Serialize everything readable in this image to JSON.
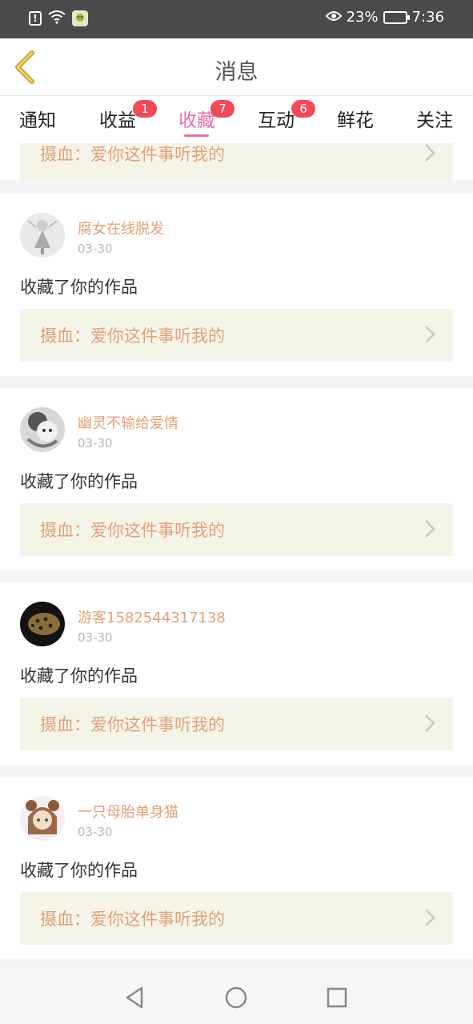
{
  "status_bar": {
    "icons": [
      "alert-icon",
      "wifi-icon",
      "app-notification-icon"
    ],
    "eye_icon": "eye-icon",
    "battery_percent": "23%",
    "time": "7:36"
  },
  "header": {
    "title": "消息",
    "back_icon": "chevron-left-icon"
  },
  "tabs": [
    {
      "label": "通知",
      "badge": ""
    },
    {
      "label": "收益",
      "badge": "1"
    },
    {
      "label": "收藏",
      "badge": "7",
      "active": true
    },
    {
      "label": "互动",
      "badge": "6"
    },
    {
      "label": "鲜花",
      "badge": ""
    },
    {
      "label": "关注",
      "badge": ""
    }
  ],
  "partial_item": {
    "work": "摄血：爱你这件事听我的"
  },
  "items": [
    {
      "username": "腐女在线脱发",
      "date": "03-30",
      "action": "收藏了你的作品",
      "work": "摄血：爱你这件事听我的"
    },
    {
      "username": "幽灵不输给爱情",
      "date": "03-30",
      "action": "收藏了你的作品",
      "work": "摄血：爱你这件事听我的"
    },
    {
      "username": "游客1582544317138",
      "date": "03-30",
      "action": "收藏了你的作品",
      "work": "摄血：爱你这件事听我的"
    },
    {
      "username": "一只母胎单身猫",
      "date": "03-30",
      "action": "收藏了你的作品",
      "work": "摄血：爱你这件事听我的"
    }
  ],
  "colors": {
    "accent": "#ec6ea6",
    "badge": "#f04a5a",
    "username": "#e0a179",
    "work_box": "#f5f4e9",
    "back_icon": "#c9a227"
  },
  "nav": {
    "back": "triangle-back-icon",
    "home": "circle-home-icon",
    "recent": "square-recent-icon"
  }
}
